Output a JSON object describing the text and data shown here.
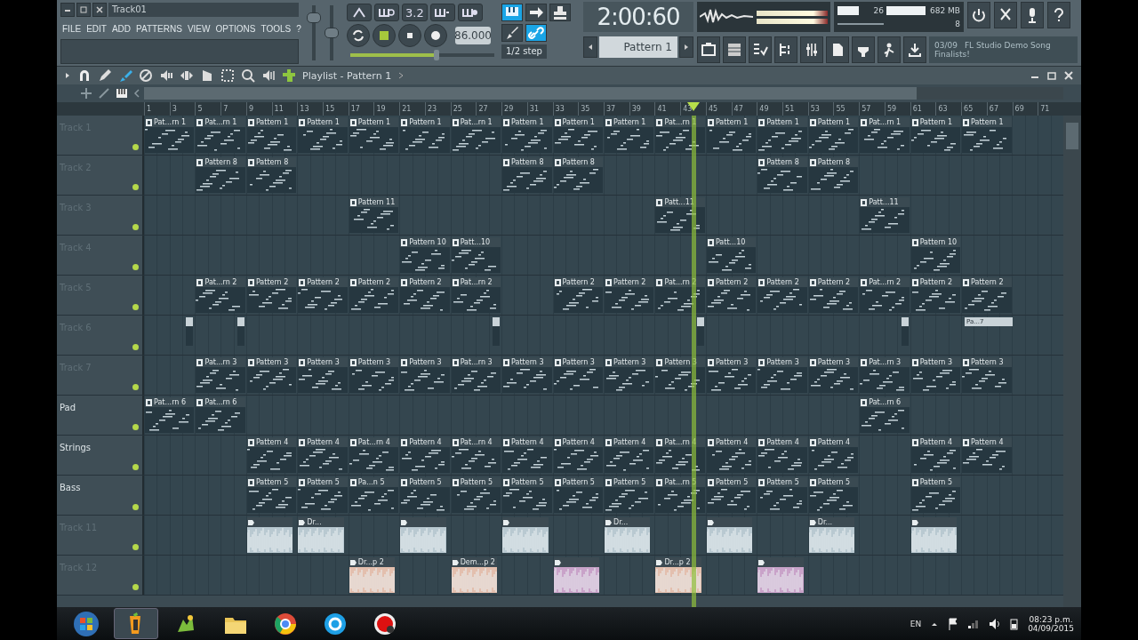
{
  "toolbar": {
    "title": "Track01",
    "menu": [
      "FILE",
      "EDIT",
      "ADD",
      "PATTERNS",
      "VIEW",
      "OPTIONS",
      "TOOLS",
      "?"
    ],
    "volume": {
      "level": 0.85
    },
    "pitch": {
      "level": 0.5
    },
    "counter": "3.2",
    "tempo": "86.000",
    "position": {
      "level": 0.6
    },
    "tools": [
      {
        "kind": "keyboard",
        "selected": true
      },
      {
        "kind": "arrow",
        "selected": false
      },
      {
        "kind": "stamp",
        "selected": false
      },
      {
        "kind": "brush",
        "selected": false
      },
      {
        "kind": "link",
        "selected": true
      }
    ],
    "snap": "1/2 step",
    "time": "2:00:60",
    "pattern": "Pattern 1",
    "cpu": "26",
    "memory": "682 MB",
    "polyphony": "8",
    "hint_index": "03/09",
    "hint_title": "FL Studio Demo Song",
    "hint_text": "Finalists!"
  },
  "playlist": {
    "title": "Playlist - Pattern 1",
    "ruler": [
      "1",
      "3",
      "5",
      "7",
      "9",
      "11",
      "13",
      "15",
      "17",
      "19",
      "21",
      "23",
      "25",
      "27",
      "29",
      "31",
      "33",
      "35",
      "37",
      "39",
      "41",
      "43",
      "45",
      "47",
      "49",
      "51",
      "53",
      "55",
      "57",
      "59",
      "61",
      "63",
      "65",
      "67",
      "69",
      "71"
    ],
    "playhead": {
      "level": 0.598
    },
    "tracks": [
      {
        "name": "Track 1",
        "dimmed": true,
        "clips": [
          {
            "kind": "pattern",
            "label": "Pat...rn 1"
          },
          {
            "kind": "pattern",
            "label": "Pat...rn 1"
          },
          {
            "kind": "pattern",
            "label": "Pattern 1"
          },
          {
            "kind": "pattern",
            "label": "Pattern 1"
          },
          {
            "kind": "pattern",
            "label": "Pattern 1"
          },
          {
            "kind": "pattern",
            "label": "Pattern 1"
          },
          {
            "kind": "pattern",
            "label": "Pat...rn 1"
          },
          {
            "kind": "pattern",
            "label": "Pattern 1"
          },
          {
            "kind": "pattern",
            "label": "Pattern 1"
          },
          {
            "kind": "pattern",
            "label": "Pattern 1"
          },
          {
            "kind": "pattern",
            "label": "Pat...rn 1"
          },
          {
            "kind": "pattern",
            "label": "Pattern 1"
          },
          {
            "kind": "pattern",
            "label": "Pattern 1"
          },
          {
            "kind": "pattern",
            "label": "Pattern 1"
          },
          {
            "kind": "pattern",
            "label": "Pat...rn 1"
          },
          {
            "kind": "pattern",
            "label": "Pattern 1"
          },
          {
            "kind": "pattern",
            "label": "Pattern 1"
          },
          {
            "kind": "empty"
          }
        ]
      },
      {
        "name": "Track 2",
        "dimmed": true,
        "clips": [
          {
            "kind": "empty"
          },
          {
            "kind": "pattern",
            "label": "Pattern 8"
          },
          {
            "kind": "pattern",
            "label": "Pattern 8"
          },
          {
            "kind": "empty"
          },
          {
            "kind": "empty"
          },
          {
            "kind": "empty"
          },
          {
            "kind": "empty"
          },
          {
            "kind": "pattern",
            "label": "Pattern 8"
          },
          {
            "kind": "pattern",
            "label": "Pattern 8"
          },
          {
            "kind": "empty"
          },
          {
            "kind": "empty"
          },
          {
            "kind": "empty"
          },
          {
            "kind": "pattern",
            "label": "Pattern 8"
          },
          {
            "kind": "pattern",
            "label": "Pattern 8"
          },
          {
            "kind": "empty"
          },
          {
            "kind": "empty"
          },
          {
            "kind": "empty"
          },
          {
            "kind": "empty"
          }
        ]
      },
      {
        "name": "Track 3",
        "dimmed": true,
        "clips": [
          {
            "kind": "empty"
          },
          {
            "kind": "empty"
          },
          {
            "kind": "empty"
          },
          {
            "kind": "empty"
          },
          {
            "kind": "pattern",
            "label": "Pattern 11"
          },
          {
            "kind": "empty"
          },
          {
            "kind": "empty"
          },
          {
            "kind": "empty"
          },
          {
            "kind": "empty"
          },
          {
            "kind": "empty"
          },
          {
            "kind": "pattern",
            "label": "Patt...11"
          },
          {
            "kind": "empty"
          },
          {
            "kind": "empty"
          },
          {
            "kind": "empty"
          },
          {
            "kind": "pattern",
            "label": "Patt...11"
          },
          {
            "kind": "empty"
          },
          {
            "kind": "empty"
          },
          {
            "kind": "empty"
          }
        ]
      },
      {
        "name": "Track 4",
        "dimmed": true,
        "clips": [
          {
            "kind": "empty"
          },
          {
            "kind": "empty"
          },
          {
            "kind": "empty"
          },
          {
            "kind": "empty"
          },
          {
            "kind": "empty"
          },
          {
            "kind": "pattern",
            "label": "Pattern 10"
          },
          {
            "kind": "pattern",
            "label": "Patt...10"
          },
          {
            "kind": "empty"
          },
          {
            "kind": "empty"
          },
          {
            "kind": "empty"
          },
          {
            "kind": "empty"
          },
          {
            "kind": "pattern",
            "label": "Patt...10"
          },
          {
            "kind": "empty"
          },
          {
            "kind": "empty"
          },
          {
            "kind": "empty"
          },
          {
            "kind": "pattern",
            "label": "Pattern 10"
          },
          {
            "kind": "empty"
          },
          {
            "kind": "empty"
          }
        ]
      },
      {
        "name": "Track 5",
        "dimmed": true,
        "clips": [
          {
            "kind": "empty"
          },
          {
            "kind": "pattern",
            "label": "Pat...rn 2"
          },
          {
            "kind": "pattern",
            "label": "Pattern 2"
          },
          {
            "kind": "pattern",
            "label": "Pattern 2"
          },
          {
            "kind": "pattern",
            "label": "Pattern 2"
          },
          {
            "kind": "pattern",
            "label": "Pattern 2"
          },
          {
            "kind": "pattern",
            "label": "Pat...rn 2"
          },
          {
            "kind": "empty"
          },
          {
            "kind": "pattern",
            "label": "Pattern 2"
          },
          {
            "kind": "pattern",
            "label": "Pattern 2"
          },
          {
            "kind": "pattern",
            "label": "Pat...rn 2"
          },
          {
            "kind": "pattern",
            "label": "Pattern 2"
          },
          {
            "kind": "pattern",
            "label": "Pattern 2"
          },
          {
            "kind": "pattern",
            "label": "Pattern 2"
          },
          {
            "kind": "pattern",
            "label": "Pat...rn 2"
          },
          {
            "kind": "pattern",
            "label": "Pattern 2"
          },
          {
            "kind": "pattern",
            "label": "Pattern 2"
          },
          {
            "kind": "empty"
          }
        ]
      },
      {
        "name": "Track 6",
        "dimmed": true,
        "clips": [
          {
            "kind": "stub"
          },
          {
            "kind": "stub"
          },
          {
            "kind": "empty"
          },
          {
            "kind": "empty"
          },
          {
            "kind": "empty"
          },
          {
            "kind": "empty"
          },
          {
            "kind": "stub"
          },
          {
            "kind": "empty"
          },
          {
            "kind": "empty"
          },
          {
            "kind": "empty"
          },
          {
            "kind": "stub"
          },
          {
            "kind": "empty"
          },
          {
            "kind": "empty"
          },
          {
            "kind": "empty"
          },
          {
            "kind": "stub"
          },
          {
            "kind": "empty"
          },
          {
            "kind": "stub",
            "label": "Pa...7"
          },
          {
            "kind": "empty"
          }
        ]
      },
      {
        "name": "Track 7",
        "dimmed": true,
        "clips": [
          {
            "kind": "empty"
          },
          {
            "kind": "pattern",
            "label": "Pat...rn 3"
          },
          {
            "kind": "pattern",
            "label": "Pattern 3"
          },
          {
            "kind": "pattern",
            "label": "Pattern 3"
          },
          {
            "kind": "pattern",
            "label": "Pattern 3"
          },
          {
            "kind": "pattern",
            "label": "Pattern 3"
          },
          {
            "kind": "pattern",
            "label": "Pat...rn 3"
          },
          {
            "kind": "pattern",
            "label": "Pattern 3"
          },
          {
            "kind": "pattern",
            "label": "Pattern 3"
          },
          {
            "kind": "pattern",
            "label": "Pattern 3"
          },
          {
            "kind": "pattern",
            "label": "Pattern 3"
          },
          {
            "kind": "pattern",
            "label": "Pattern 3"
          },
          {
            "kind": "pattern",
            "label": "Pattern 3"
          },
          {
            "kind": "pattern",
            "label": "Pattern 3"
          },
          {
            "kind": "pattern",
            "label": "Pat...rn 3"
          },
          {
            "kind": "pattern",
            "label": "Pattern 3"
          },
          {
            "kind": "pattern",
            "label": "Pattern 3"
          },
          {
            "kind": "empty"
          }
        ]
      },
      {
        "name": "Pad",
        "dimmed": false,
        "clips": [
          {
            "kind": "pattern",
            "label": "Pat...rn 6"
          },
          {
            "kind": "pattern",
            "label": "Pat...rn 6"
          },
          {
            "kind": "empty"
          },
          {
            "kind": "empty"
          },
          {
            "kind": "empty"
          },
          {
            "kind": "empty"
          },
          {
            "kind": "empty"
          },
          {
            "kind": "empty"
          },
          {
            "kind": "empty"
          },
          {
            "kind": "empty"
          },
          {
            "kind": "empty"
          },
          {
            "kind": "empty"
          },
          {
            "kind": "empty"
          },
          {
            "kind": "empty"
          },
          {
            "kind": "pattern",
            "label": "Pat...rn 6"
          },
          {
            "kind": "empty"
          },
          {
            "kind": "empty"
          },
          {
            "kind": "empty"
          }
        ]
      },
      {
        "name": "Strings",
        "dimmed": false,
        "clips": [
          {
            "kind": "empty"
          },
          {
            "kind": "empty"
          },
          {
            "kind": "pattern",
            "label": "Pattern 4"
          },
          {
            "kind": "pattern",
            "label": "Pattern 4"
          },
          {
            "kind": "pattern",
            "label": "Pat...rn 4"
          },
          {
            "kind": "pattern",
            "label": "Pattern 4"
          },
          {
            "kind": "pattern",
            "label": "Pat...rn 4"
          },
          {
            "kind": "pattern",
            "label": "Pattern 4"
          },
          {
            "kind": "pattern",
            "label": "Pattern 4"
          },
          {
            "kind": "pattern",
            "label": "Pattern 4"
          },
          {
            "kind": "pattern",
            "label": "Pat...rn 4"
          },
          {
            "kind": "pattern",
            "label": "Pattern 4"
          },
          {
            "kind": "pattern",
            "label": "Pattern 4"
          },
          {
            "kind": "pattern",
            "label": "Pattern 4"
          },
          {
            "kind": "empty"
          },
          {
            "kind": "pattern",
            "label": "Pattern 4"
          },
          {
            "kind": "pattern",
            "label": "Pattern 4"
          },
          {
            "kind": "empty"
          }
        ]
      },
      {
        "name": "Bass",
        "dimmed": false,
        "clips": [
          {
            "kind": "empty"
          },
          {
            "kind": "empty"
          },
          {
            "kind": "pattern",
            "label": "Pattern 5"
          },
          {
            "kind": "pattern",
            "label": "Pattern 5"
          },
          {
            "kind": "pattern",
            "label": "Pa...n 5"
          },
          {
            "kind": "pattern",
            "label": "Pattern 5"
          },
          {
            "kind": "pattern",
            "label": "Pattern 5"
          },
          {
            "kind": "pattern",
            "label": "Pattern 5"
          },
          {
            "kind": "pattern",
            "label": "Pattern 5"
          },
          {
            "kind": "pattern",
            "label": "Pattern 5"
          },
          {
            "kind": "pattern",
            "label": "Pat...rn 5"
          },
          {
            "kind": "pattern",
            "label": "Pattern 5"
          },
          {
            "kind": "pattern",
            "label": "Pattern 5"
          },
          {
            "kind": "pattern",
            "label": "Pattern 5"
          },
          {
            "kind": "empty"
          },
          {
            "kind": "pattern",
            "label": "Pattern 5"
          },
          {
            "kind": "empty"
          },
          {
            "kind": "empty"
          }
        ]
      },
      {
        "name": "Track 11",
        "dimmed": true,
        "clips": [
          {
            "kind": "empty"
          },
          {
            "kind": "empty"
          },
          {
            "kind": "audio",
            "color": "#b9c9d1"
          },
          {
            "kind": "audio",
            "color": "#b9c9d1",
            "label": "Dr..."
          },
          {
            "kind": "empty"
          },
          {
            "kind": "audio",
            "color": "#b9c9d1"
          },
          {
            "kind": "empty"
          },
          {
            "kind": "audio",
            "color": "#b9c9d1"
          },
          {
            "kind": "empty"
          },
          {
            "kind": "audio",
            "color": "#b9c9d1",
            "label": "Dr..."
          },
          {
            "kind": "empty"
          },
          {
            "kind": "audio",
            "color": "#b9c9d1"
          },
          {
            "kind": "empty"
          },
          {
            "kind": "audio",
            "color": "#b9c9d1",
            "label": "Dr..."
          },
          {
            "kind": "empty"
          },
          {
            "kind": "audio",
            "color": "#b9c9d1"
          },
          {
            "kind": "empty"
          },
          {
            "kind": "empty"
          }
        ]
      },
      {
        "name": "Track 12",
        "dimmed": true,
        "clips": [
          {
            "kind": "empty"
          },
          {
            "kind": "empty"
          },
          {
            "kind": "empty"
          },
          {
            "kind": "empty"
          },
          {
            "kind": "audio",
            "color": "#e3bfae",
            "label": "Dr...p 2"
          },
          {
            "kind": "empty"
          },
          {
            "kind": "audio",
            "color": "#e3bfae",
            "label": "Dem...p 2"
          },
          {
            "kind": "empty"
          },
          {
            "kind": "audio",
            "color": "#c9a3c9"
          },
          {
            "kind": "empty"
          },
          {
            "kind": "audio",
            "color": "#e3bfae",
            "label": "Dr...p 2"
          },
          {
            "kind": "empty"
          },
          {
            "kind": "audio",
            "color": "#c9a3c9"
          },
          {
            "kind": "empty"
          },
          {
            "kind": "empty"
          },
          {
            "kind": "empty"
          },
          {
            "kind": "empty"
          },
          {
            "kind": "empty"
          }
        ]
      }
    ]
  },
  "taskbar": {
    "apps": [
      {
        "kind": "fl",
        "selected": true
      },
      {
        "kind": "bird",
        "selected": false
      },
      {
        "kind": "folder",
        "selected": false
      },
      {
        "kind": "browser",
        "selected": false
      },
      {
        "kind": "chat",
        "selected": false
      },
      {
        "kind": "record",
        "selected": false
      }
    ],
    "language": "EN",
    "clock": "08:23 p.m.",
    "date": "04/09/2015"
  }
}
